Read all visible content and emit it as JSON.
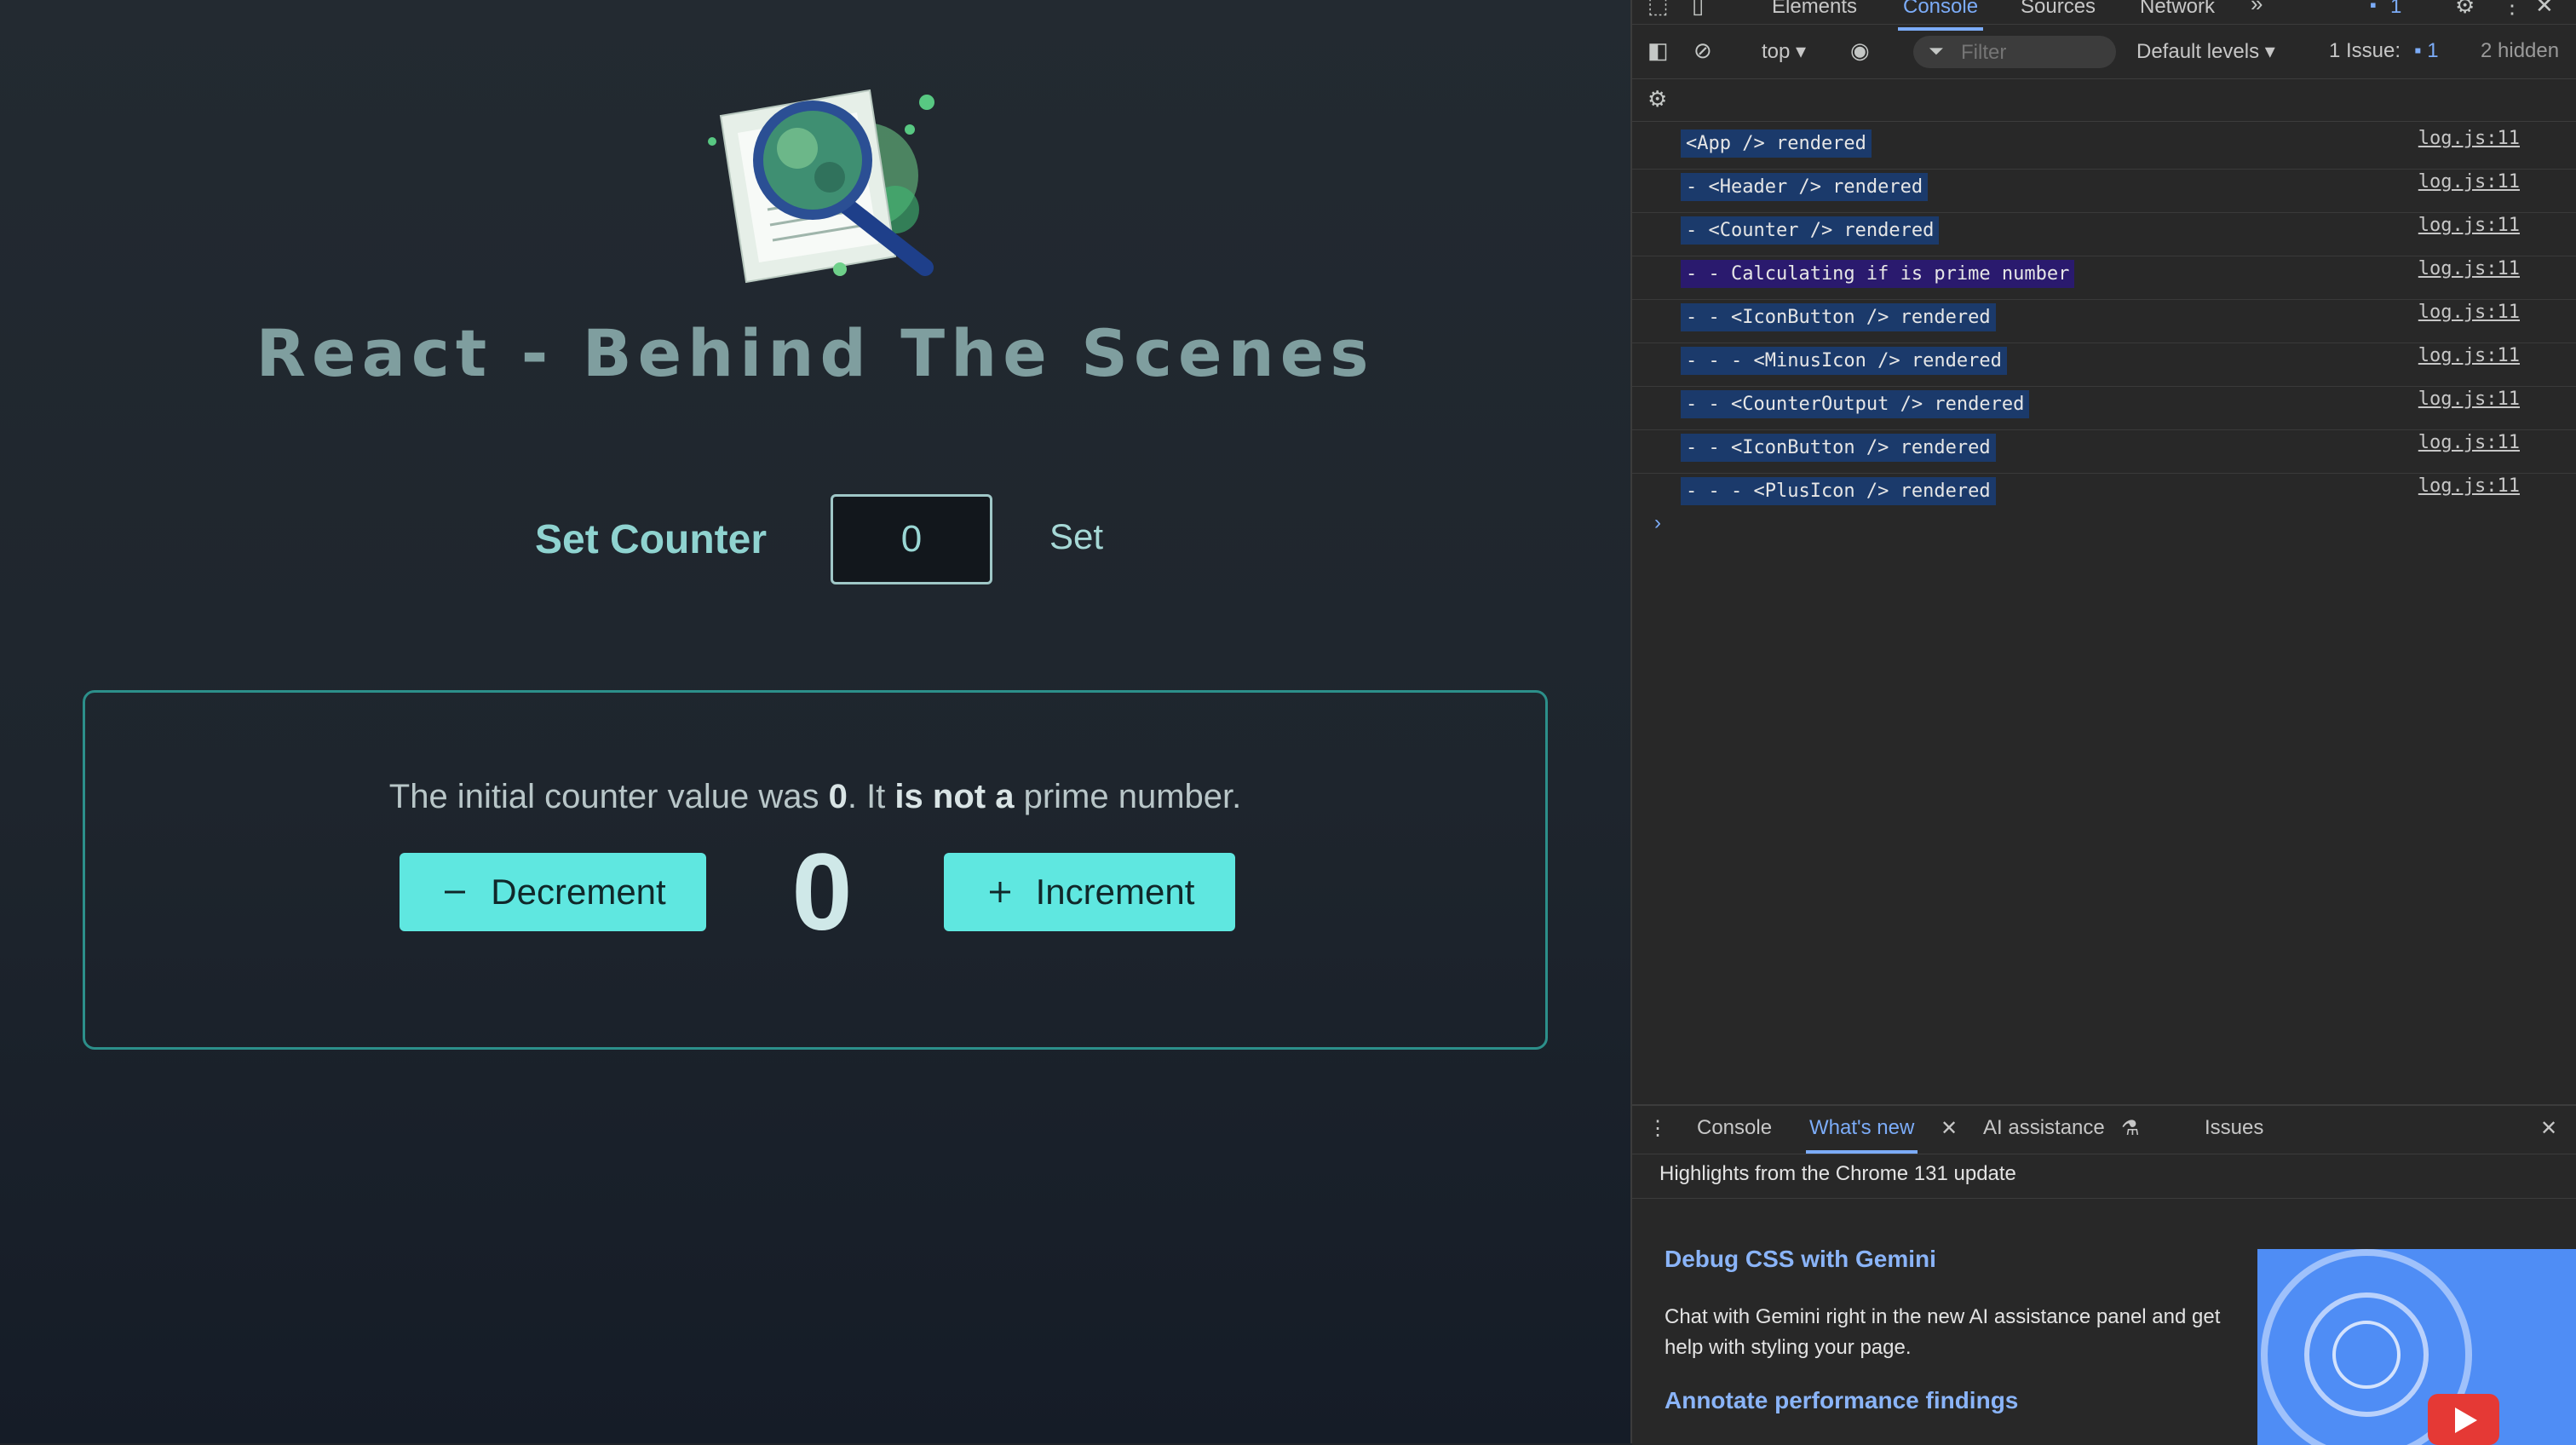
{
  "app": {
    "title": "React - Behind The Scenes",
    "set_counter_label": "Set Counter",
    "set_counter_value": "0",
    "set_button": "Set",
    "counter": {
      "info_prefix": "The initial counter value was ",
      "initial_value": "0",
      "info_middle": ". It ",
      "info_verdict": "is not a",
      "info_suffix": " prime number.",
      "decrement_label": "Decrement",
      "increment_label": "Increment",
      "value": "0"
    }
  },
  "devtools": {
    "tabs": [
      "Elements",
      "Console",
      "Sources",
      "Network"
    ],
    "active_tab": "Console",
    "issues_badge": "1",
    "toolbar": {
      "context": "top",
      "filter_placeholder": "Filter",
      "levels": "Default levels",
      "issues_label": "1 Issue:",
      "issues_count": "1",
      "hidden": "2 hidden"
    },
    "logs": [
      {
        "message": "<App /> rendered",
        "source": "log.js:11"
      },
      {
        "message": "- <Header /> rendered",
        "source": "log.js:11"
      },
      {
        "message": "- <Counter /> rendered",
        "source": "log.js:11"
      },
      {
        "message": "- - Calculating if is prime number",
        "source": "log.js:11"
      },
      {
        "message": "- - <IconButton /> rendered",
        "source": "log.js:11"
      },
      {
        "message": "- - - <MinusIcon /> rendered",
        "source": "log.js:11"
      },
      {
        "message": "- - <CounterOutput /> rendered",
        "source": "log.js:11"
      },
      {
        "message": "- - <IconButton /> rendered",
        "source": "log.js:11"
      },
      {
        "message": "- - - <PlusIcon /> rendered",
        "source": "log.js:11"
      }
    ],
    "drawer": {
      "tabs": [
        "Console",
        "What's new",
        "AI assistance",
        "Issues"
      ],
      "active_tab": "What's new",
      "highlights": "Highlights from the Chrome 131 update",
      "feature1_title": "Debug CSS with Gemini",
      "feature1_desc": "Chat with Gemini right in the new AI assistance panel and get help with styling your page.",
      "feature2_title": "Annotate performance findings"
    }
  },
  "colors": {
    "accent": "#5fe7e0",
    "devtools_link": "#7cacf8",
    "log_highlight": "#1b3a6b"
  }
}
